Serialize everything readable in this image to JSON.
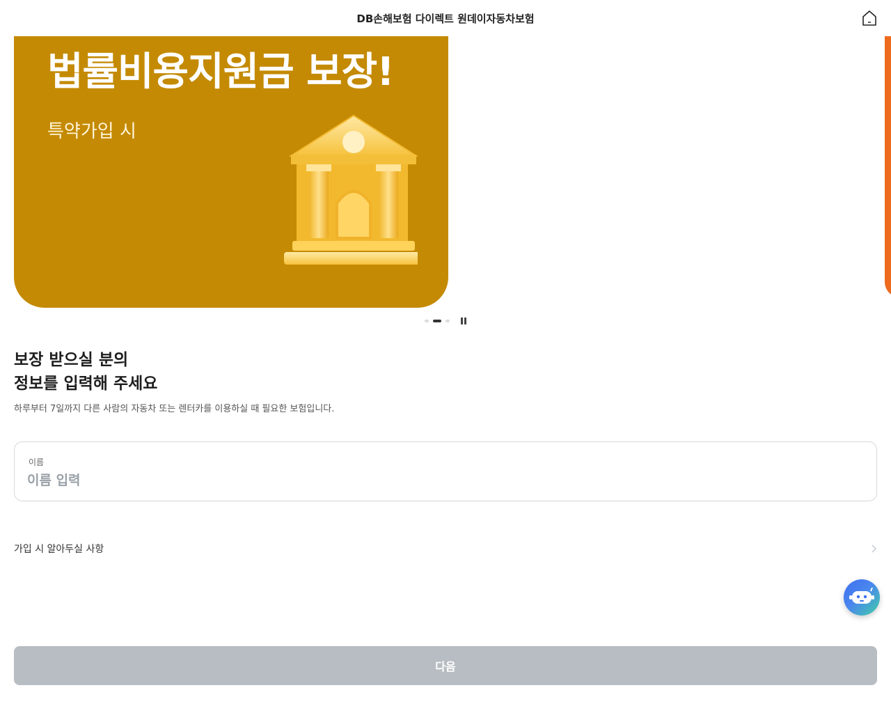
{
  "header": {
    "title": "DB손해보험 다이렉트 원데이자동차보험",
    "home_icon": "home-icon"
  },
  "banner": {
    "title": "법률비용지원금 보장!",
    "subtitle": "특약가입 시",
    "background_color": "#c48a03",
    "illustration": "courthouse-icon"
  },
  "carousel": {
    "slide_count": 3,
    "active_index": 1,
    "control_icon": "pause-icon"
  },
  "form": {
    "heading_line1": "보장 받으실 분의",
    "heading_line2": "정보를 입력해 주세요",
    "description": "하루부터 7일까지 다른 사람의 자동차 또는 렌터카를 이용하실 때 필요한 보험입니다.",
    "name_field": {
      "label": "이름",
      "placeholder": "이름 입력",
      "value": ""
    },
    "notice": {
      "label": "가입 시 알아두실 사항",
      "icon": "chevron-right-icon"
    }
  },
  "chatbot": {
    "icon": "chatbot-icon"
  },
  "footer": {
    "next_label": "다음",
    "button_color": "#b8bdc3"
  }
}
